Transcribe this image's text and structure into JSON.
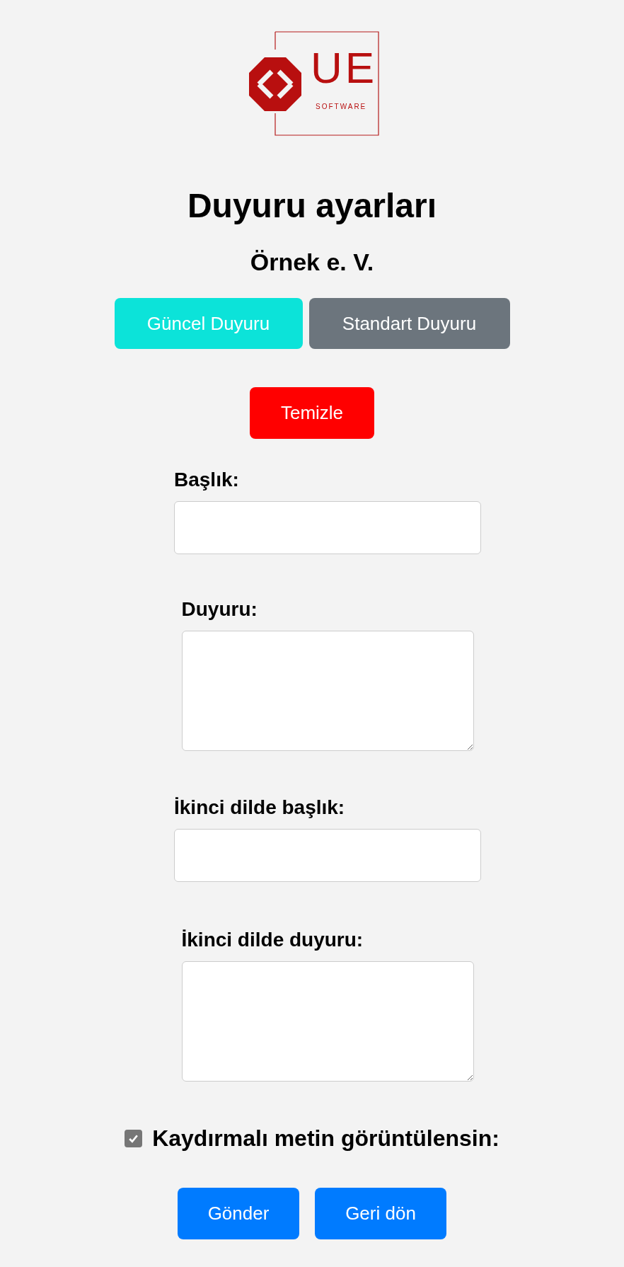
{
  "logo": {
    "mark": "UE",
    "tagline": "SOFTWARE"
  },
  "title": "Duyuru ayarları",
  "subtitle": "Örnek e. V.",
  "tabs": [
    {
      "label": "Güncel Duyuru",
      "selected": true
    },
    {
      "label": "Standart Duyuru",
      "selected": false
    }
  ],
  "clear_button": "Temizle",
  "fields": [
    {
      "label": "Başlık:",
      "kind": "input"
    },
    {
      "label": "Duyuru:",
      "kind": "textarea"
    },
    {
      "label": "İkinci dilde başlık:",
      "kind": "input"
    },
    {
      "label": "İkinci dilde duyuru:",
      "kind": "textarea"
    }
  ],
  "scrolling_text": {
    "label": "Kaydırmalı metin görüntülensin:",
    "checked": true
  },
  "buttons": [
    "Gönder",
    "Geri dön"
  ]
}
